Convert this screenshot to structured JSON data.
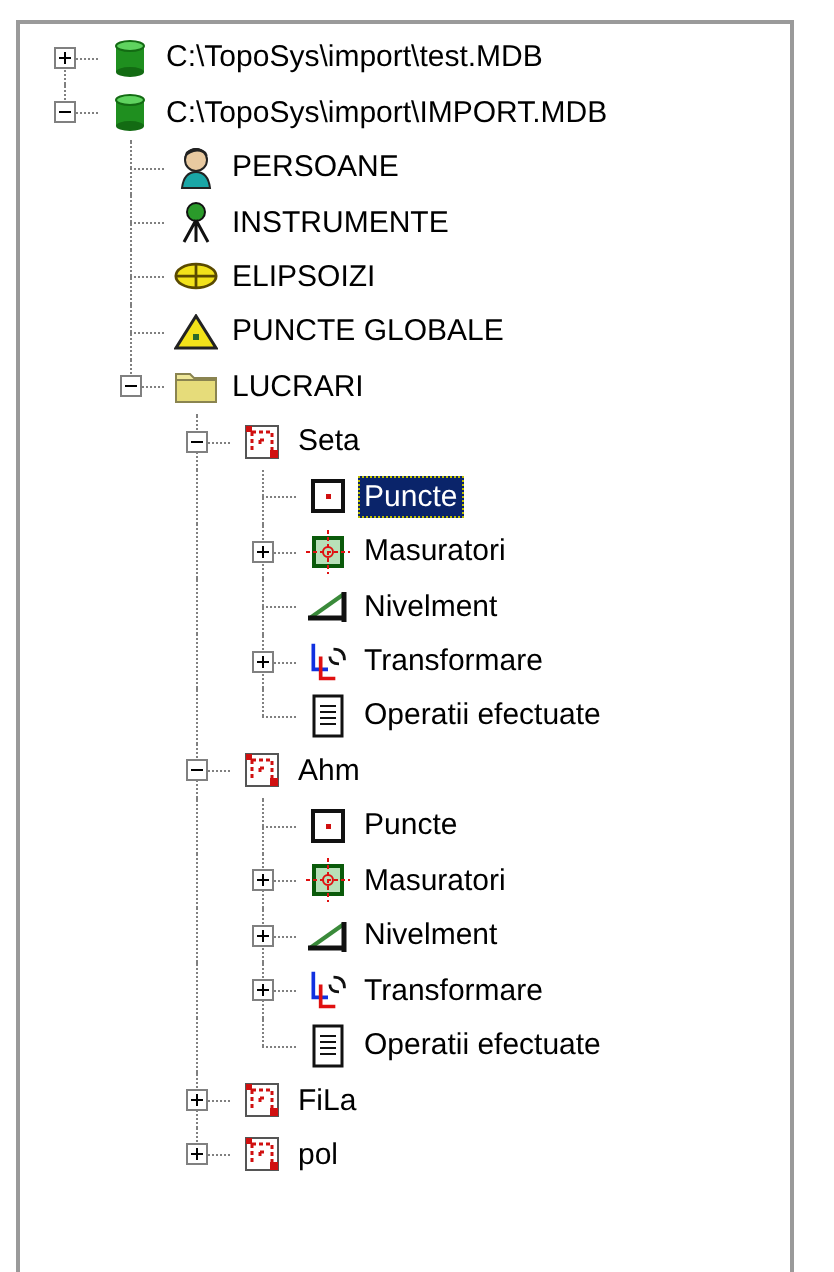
{
  "tree": {
    "items": [
      {
        "label": "C:\\TopoSys\\import\\test.MDB",
        "kind": "database",
        "expanded": false,
        "selected": false
      },
      {
        "label": "C:\\TopoSys\\import\\IMPORT.MDB",
        "kind": "database",
        "expanded": true,
        "selected": false,
        "children": [
          {
            "label": "PERSOANE",
            "kind": "person",
            "selected": false
          },
          {
            "label": "INSTRUMENTE",
            "kind": "tripod",
            "selected": false
          },
          {
            "label": "ELIPSOIZI",
            "kind": "ellipsoid",
            "selected": false
          },
          {
            "label": "PUNCTE GLOBALE",
            "kind": "triangle",
            "selected": false
          },
          {
            "label": "LUCRARI",
            "kind": "folder",
            "expanded": true,
            "selected": false,
            "children": [
              {
                "label": "Seta",
                "kind": "project",
                "expanded": true,
                "selected": false,
                "children": [
                  {
                    "label": "Puncte",
                    "kind": "points",
                    "selected": true
                  },
                  {
                    "label": "Masuratori",
                    "kind": "measure",
                    "expanded": false,
                    "selected": false
                  },
                  {
                    "label": "Nivelment",
                    "kind": "level",
                    "selected": false
                  },
                  {
                    "label": "Transformare",
                    "kind": "transform",
                    "expanded": false,
                    "selected": false
                  },
                  {
                    "label": "Operatii efectuate",
                    "kind": "log",
                    "selected": false
                  }
                ]
              },
              {
                "label": "Ahm",
                "kind": "project",
                "expanded": true,
                "selected": false,
                "children": [
                  {
                    "label": "Puncte",
                    "kind": "points",
                    "selected": false
                  },
                  {
                    "label": "Masuratori",
                    "kind": "measure",
                    "expanded": false,
                    "selected": false
                  },
                  {
                    "label": "Nivelment",
                    "kind": "level",
                    "expanded": false,
                    "selected": false
                  },
                  {
                    "label": "Transformare",
                    "kind": "transform",
                    "expanded": false,
                    "selected": false
                  },
                  {
                    "label": "Operatii efectuate",
                    "kind": "log",
                    "selected": false
                  }
                ]
              },
              {
                "label": "FiLa",
                "kind": "project",
                "expanded": false,
                "selected": false
              },
              {
                "label": "pol",
                "kind": "project",
                "expanded": false,
                "selected": false
              }
            ]
          }
        ]
      }
    ]
  }
}
